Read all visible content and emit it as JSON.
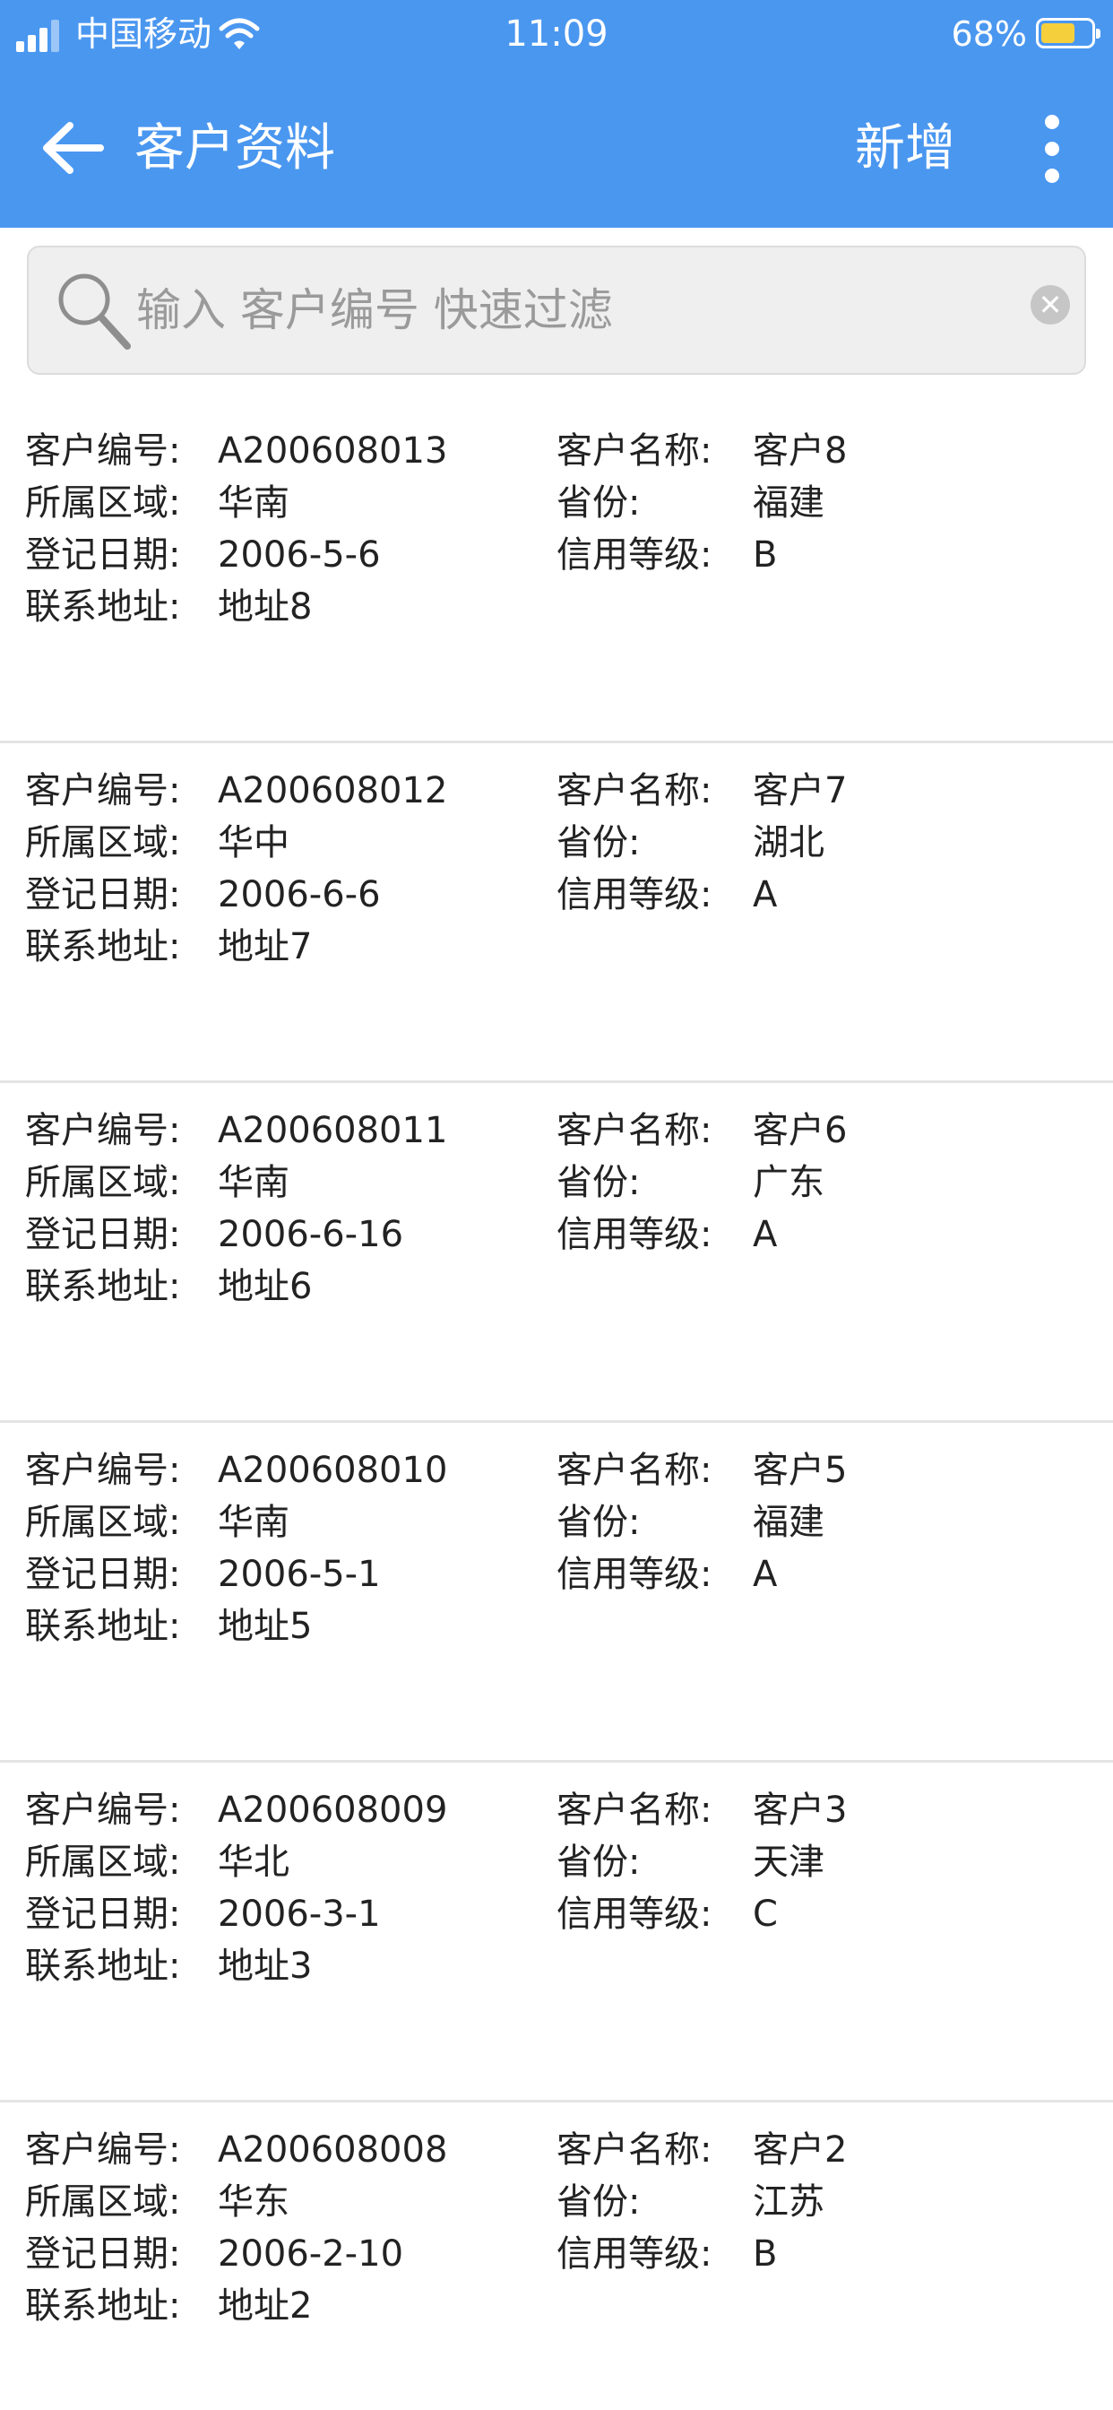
{
  "status_bar": {
    "carrier": "中国移动",
    "time": "11:09",
    "battery_percent": "68%",
    "battery_level": 0.68,
    "icons": [
      "signal-icon",
      "wifi-icon",
      "battery-icon"
    ]
  },
  "app_bar": {
    "title": "客户资料",
    "add_label": "新增",
    "icons": [
      "back-arrow-icon",
      "more-vertical-icon"
    ]
  },
  "search": {
    "value": "",
    "placeholder": "输入 客户编号 快速过滤",
    "icons": [
      "search-icon",
      "clear-icon"
    ]
  },
  "labels": {
    "customer_no": "客户编号:",
    "customer_name": "客户名称:",
    "region": "所属区域:",
    "province": "省份:",
    "register_date": "登记日期:",
    "credit_level": "信用等级:",
    "address": "联系地址:"
  },
  "customers": [
    {
      "no": "A200608013",
      "name": "客户8",
      "region": "华南",
      "province": "福建",
      "date": "2006-5-6",
      "credit": "B",
      "address": "地址8"
    },
    {
      "no": "A200608012",
      "name": "客户7",
      "region": "华中",
      "province": "湖北",
      "date": "2006-6-6",
      "credit": "A",
      "address": "地址7"
    },
    {
      "no": "A200608011",
      "name": "客户6",
      "region": "华南",
      "province": "广东",
      "date": "2006-6-16",
      "credit": "A",
      "address": "地址6"
    },
    {
      "no": "A200608010",
      "name": "客户5",
      "region": "华南",
      "province": "福建",
      "date": "2006-5-1",
      "credit": "A",
      "address": "地址5"
    },
    {
      "no": "A200608009",
      "name": "客户3",
      "region": "华北",
      "province": "天津",
      "date": "2006-3-1",
      "credit": "C",
      "address": "地址3"
    },
    {
      "no": "A200608008",
      "name": "客户2",
      "region": "华东",
      "province": "江苏",
      "date": "2006-2-10",
      "credit": "B",
      "address": "地址2"
    }
  ],
  "colors": {
    "header_bg": "#4a97f0",
    "battery_fill": "#f5cf3c",
    "divider": "#e4e4e4"
  }
}
